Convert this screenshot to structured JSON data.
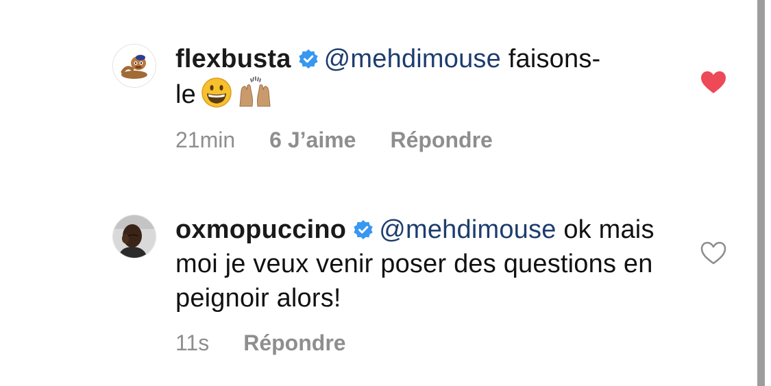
{
  "comments": [
    {
      "username": "flexbusta",
      "mention": "@mehdimouse",
      "text_line1": "faisons-",
      "text_line2": "le",
      "emojis": [
        "grinning-face",
        "raising-hands"
      ],
      "time": "21min",
      "likes": "6 J’aime",
      "reply": "Répondre",
      "liked": true,
      "verified": true
    },
    {
      "username": "oxmopuccino",
      "mention": "@mehdimouse",
      "text": "ok mais moi je veux venir poser des questions en peignoir alors!",
      "time": "11s",
      "reply": "Répondre",
      "liked": false,
      "verified": true
    }
  ],
  "colors": {
    "verified_blue": "#3897f0",
    "mention": "#1d3d6e",
    "meta_gray": "#8e8e8e",
    "heart_red": "#ed4956",
    "scrollbar": "#9d9d9d"
  },
  "icons": {
    "verified": "verified-badge-icon",
    "liked": "heart-filled-icon",
    "unliked": "heart-outline-icon"
  }
}
